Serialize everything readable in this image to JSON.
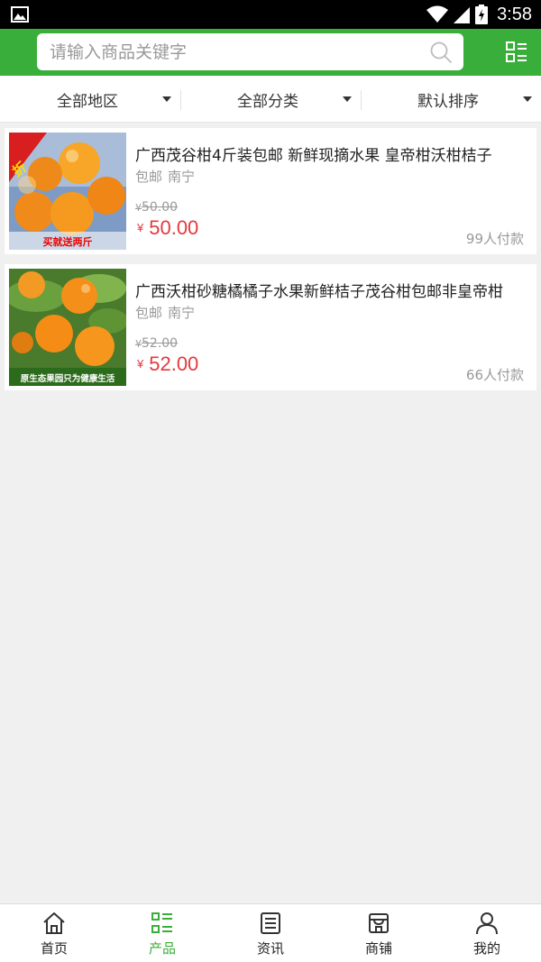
{
  "status_bar": {
    "time": "3:58"
  },
  "search": {
    "placeholder": "请输入商品关键字",
    "value": ""
  },
  "filters": [
    {
      "label": "全部地区"
    },
    {
      "label": "全部分类"
    },
    {
      "label": "默认排序"
    }
  ],
  "products": [
    {
      "title": "广西茂谷柑4斤装包邮 新鲜现摘水果 皇帝柑沃柑桔子",
      "shipping": "包邮",
      "location": "南宁",
      "currency_symbol": "¥",
      "old_price": "50.00",
      "price": "50.00",
      "sold": "99人付款",
      "image_banner": "买就送两斤",
      "image_badge": "折"
    },
    {
      "title": "广西沃柑砂糖橘橘子水果新鲜桔子茂谷柑包邮非皇帝柑",
      "shipping": "包邮",
      "location": "南宁",
      "currency_symbol": "¥",
      "old_price": "52.00",
      "price": "52.00",
      "sold": "66人付款",
      "image_banner": "原生态果园只为健康生活"
    }
  ],
  "tabs": [
    {
      "label": "首页",
      "icon": "home-icon",
      "active": false
    },
    {
      "label": "产品",
      "icon": "product-list-icon",
      "active": true
    },
    {
      "label": "资讯",
      "icon": "news-icon",
      "active": false
    },
    {
      "label": "商铺",
      "icon": "shop-icon",
      "active": false
    },
    {
      "label": "我的",
      "icon": "user-icon",
      "active": false
    }
  ],
  "colors": {
    "brand_green": "#3aae3a",
    "price_red": "#e4393c",
    "muted_text": "#999999",
    "background": "#f0f0f0"
  }
}
